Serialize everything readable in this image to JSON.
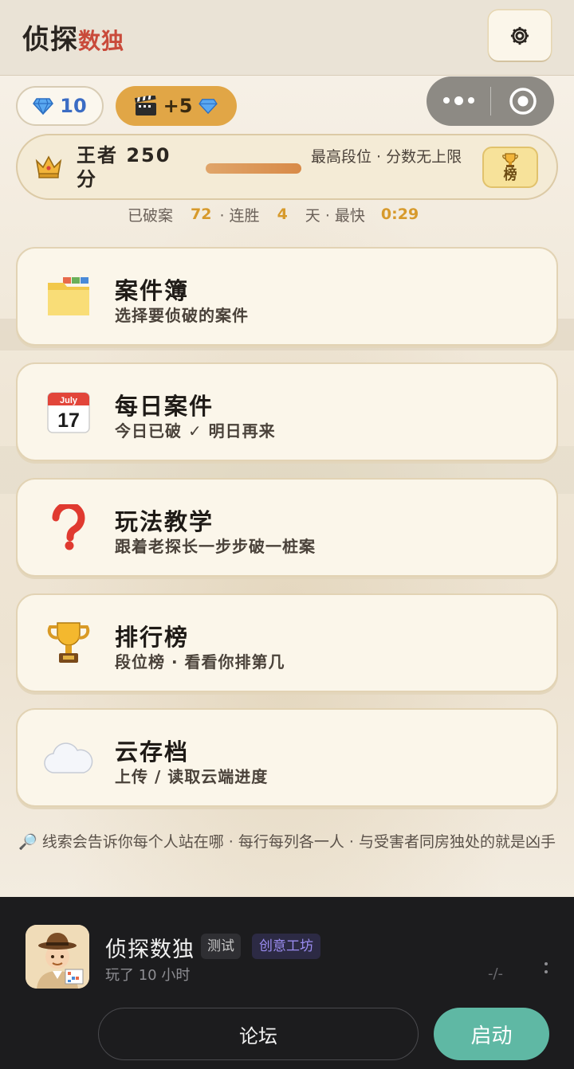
{
  "header": {
    "title_main": "侦探",
    "title_accent": "数独",
    "settings_icon": "gear-icon"
  },
  "currency": {
    "gems": "10",
    "video_reward": "+5"
  },
  "rank": {
    "label": "王者 250 分",
    "note": "最高段位 · 分数无上限",
    "board_label": "榜",
    "progress": 1.0
  },
  "stats": {
    "solved_label": "已破案",
    "solved": "72",
    "streak_label": "· 连胜",
    "streak": "4",
    "fastest_label": "天 · 最快",
    "fastest": "0:29"
  },
  "menu": [
    {
      "title": "案件簿",
      "subtitle": "选择要侦破的案件",
      "icon": "folder-icon"
    },
    {
      "title": "每日案件",
      "subtitle": "今日已破 ✓ 明日再来",
      "icon": "calendar-icon"
    },
    {
      "title": "玩法教学",
      "subtitle": "跟着老探长一步步破一桩案",
      "icon": "question-icon"
    },
    {
      "title": "排行榜",
      "subtitle": "段位榜 · 看看你排第几",
      "icon": "trophy-icon"
    },
    {
      "title": "云存档",
      "subtitle": "上传 / 读取云端进度",
      "icon": "cloud-icon"
    }
  ],
  "calendar": {
    "month": "July",
    "day": "17"
  },
  "hint": "🔎 线索会告诉你每个人站在哪 · 每行每列各一人 · 与受害者同房独处的就是凶手",
  "sheet": {
    "app_name": "侦探数独",
    "tag_test": "测试",
    "tag_workshop": "创意工坊",
    "played": "玩了 10 小时",
    "dash": "-/-",
    "forum_label": "论坛",
    "launch_label": "启动"
  },
  "colors": {
    "accent_red": "#c94a3a",
    "gold": "#e1a646",
    "teal": "#5fb8a4",
    "gem_blue": "#3b6cc4"
  }
}
